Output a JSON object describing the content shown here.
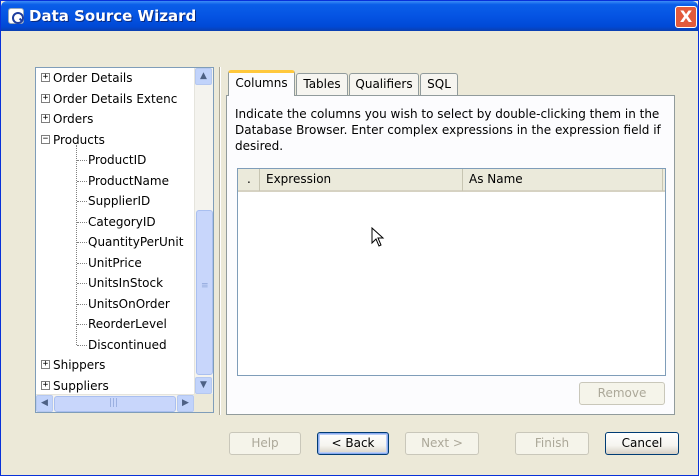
{
  "window": {
    "title": "Data Source Wizard",
    "close_glyph": "X"
  },
  "tree": {
    "items": [
      {
        "label": "Order Details",
        "type": "collapsed"
      },
      {
        "label": "Order Details Extenc",
        "type": "collapsed"
      },
      {
        "label": "Orders",
        "type": "collapsed"
      },
      {
        "label": "Products",
        "type": "expanded"
      },
      {
        "label": "ProductID",
        "type": "child"
      },
      {
        "label": "ProductName",
        "type": "child"
      },
      {
        "label": "SupplierID",
        "type": "child"
      },
      {
        "label": "CategoryID",
        "type": "child"
      },
      {
        "label": "QuantityPerUnit",
        "type": "child"
      },
      {
        "label": "UnitPrice",
        "type": "child"
      },
      {
        "label": "UnitsInStock",
        "type": "child"
      },
      {
        "label": "UnitsOnOrder",
        "type": "child"
      },
      {
        "label": "ReorderLevel",
        "type": "child"
      },
      {
        "label": "Discontinued",
        "type": "child"
      },
      {
        "label": "Shippers",
        "type": "collapsed"
      },
      {
        "label": "Suppliers",
        "type": "collapsed"
      }
    ],
    "plus": "+",
    "minus": "−",
    "scroll_up": "▲",
    "scroll_down": "▼",
    "scroll_left": "◀",
    "scroll_right": "▶"
  },
  "tabs": [
    {
      "label": "Columns",
      "active": true
    },
    {
      "label": "Tables",
      "active": false
    },
    {
      "label": "Qualifiers",
      "active": false
    },
    {
      "label": "SQL",
      "active": false
    }
  ],
  "columns_tab": {
    "instructions": "Indicate the columns you wish to select by double-clicking them in the Database Browser.  Enter complex expressions in the expression field if desired.",
    "grid_headers": [
      ".",
      "Expression",
      "As Name"
    ],
    "remove_label": "Remove"
  },
  "footer": {
    "help_label": "Help",
    "back_label": "< Back",
    "next_label": "Next >",
    "finish_label": "Finish",
    "cancel_label": "Cancel"
  }
}
